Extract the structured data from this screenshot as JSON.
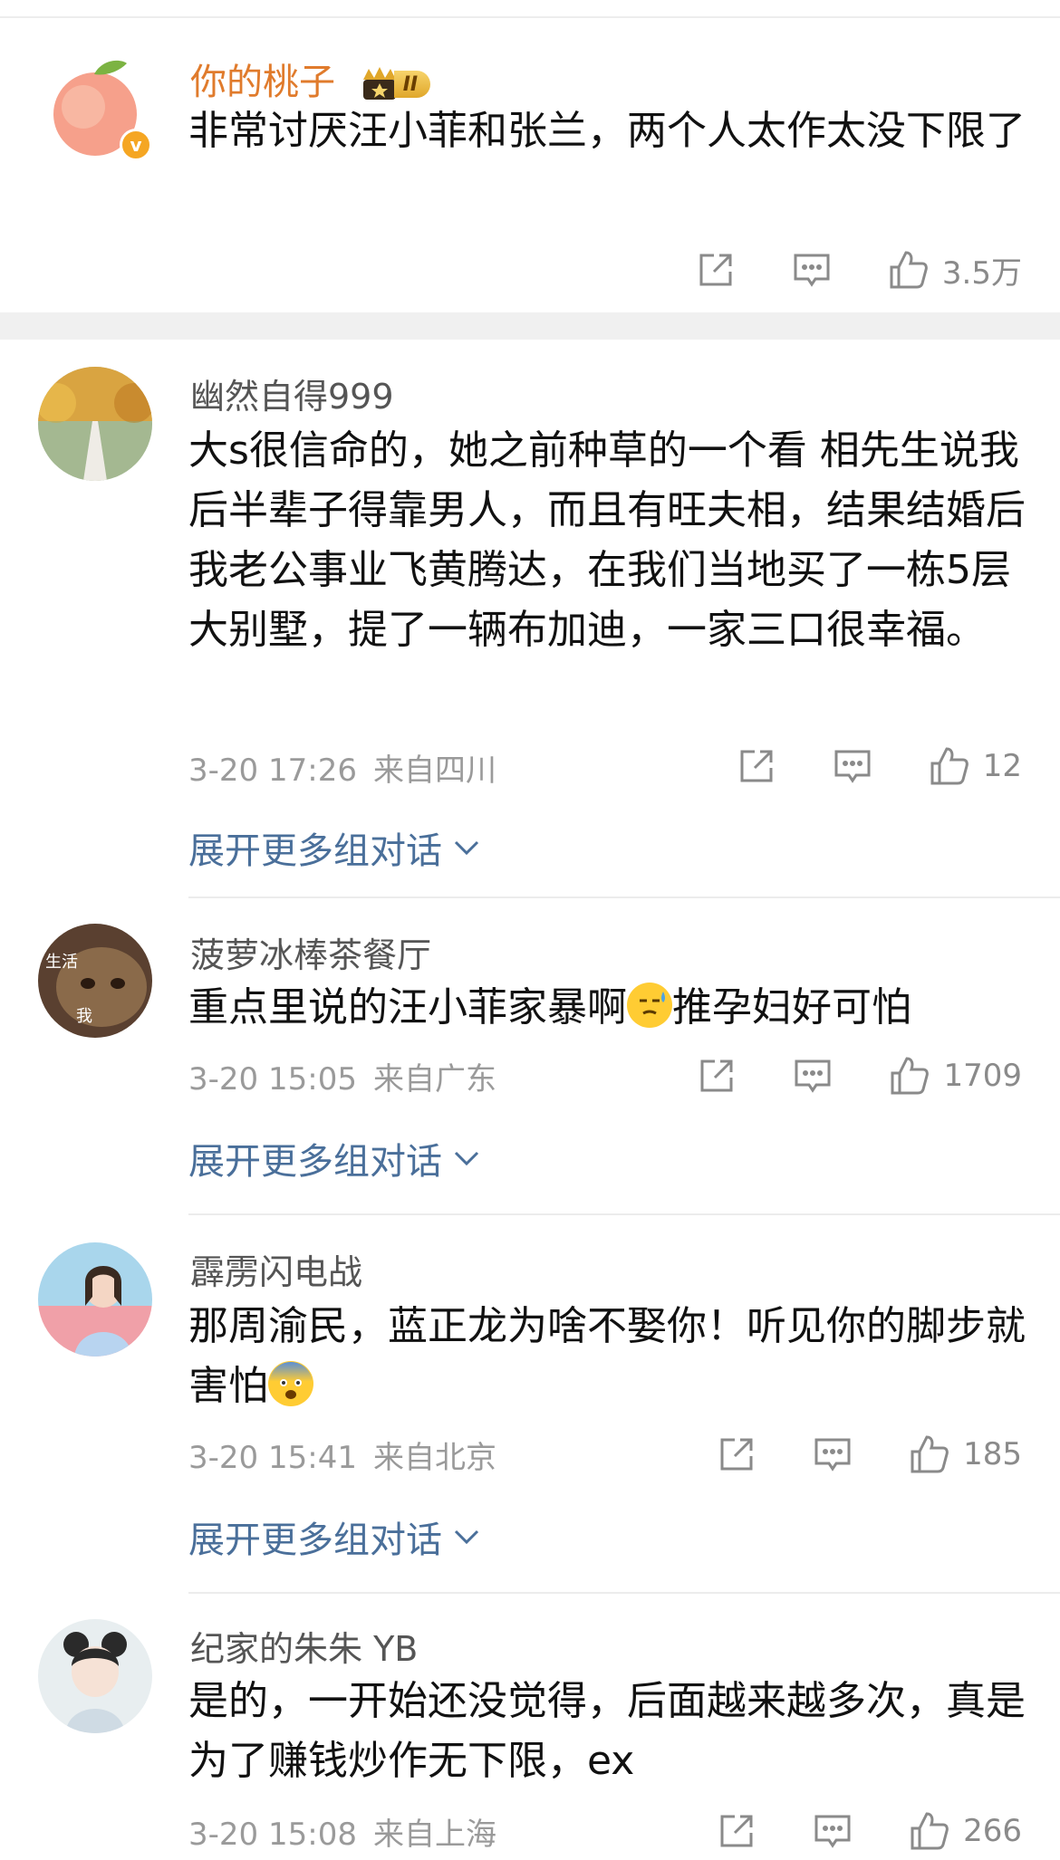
{
  "comments": [
    {
      "username": "你的桃子",
      "level_badge": "II",
      "verified_mark": "v",
      "text": "非常讨厌汪小菲和张兰，两个人太作太没下限了",
      "likes": "3.5万"
    },
    {
      "username": "幽然自得999",
      "text": "大s很信命的，她之前种草的一个看 相先生说我后半辈子得靠男人，而且有旺夫相，结果结婚后我老公事业飞黄腾达，在我们当地买了一栋5层大别墅，提了一辆布加迪，一家三口很幸福。",
      "time": "3-20 17:26",
      "location": "来自四川",
      "likes": "12",
      "expand_label": "展开更多组对话"
    },
    {
      "username": "菠萝冰棒茶餐厅",
      "avatar_text_top": "生活",
      "avatar_text_bottom": "我",
      "text_before": "重点里说的汪小菲家暴啊",
      "text_after": "推孕妇好可怕",
      "time": "3-20 15:05",
      "location": "来自广东",
      "likes": "1709",
      "expand_label": "展开更多组对话"
    },
    {
      "username": "霹雳闪电战",
      "text_before": "那周渝民，蓝正龙为啥不娶你！听见你的脚步就害怕",
      "time": "3-20 15:41",
      "location": "来自北京",
      "likes": "185",
      "expand_label": "展开更多组对话"
    },
    {
      "username": "纪家的朱朱 YB",
      "text": "是的，一开始还没觉得，后面越来越多次，真是为了赚钱炒作无下限，ex",
      "time": "3-20 15:08",
      "location": "来自上海",
      "likes": "266"
    }
  ],
  "colors": {
    "username_highlight": "#e07b2c",
    "username": "#555555",
    "link": "#4a6f9a",
    "meta": "#9a9a9a"
  },
  "icons": [
    "share-icon",
    "reply-icon",
    "like-icon",
    "chevron-down-icon",
    "crown-icon",
    "verified-icon"
  ]
}
